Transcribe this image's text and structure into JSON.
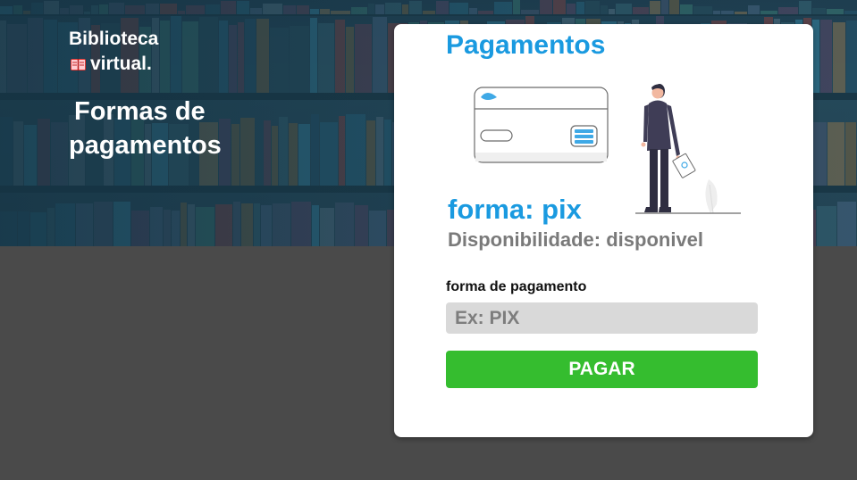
{
  "brand": {
    "line1": "Biblioteca",
    "line2": "virtual.",
    "icon": "book-icon"
  },
  "page_title": {
    "line1": "Formas de",
    "line2": "pagamentos"
  },
  "card": {
    "title": "Pagamentos",
    "illustration": "payment-card-person-illustration",
    "method_label": "forma: pix",
    "availability_label": "Disponibilidade: disponivel",
    "input_label": "forma de pagamento",
    "input_value": "",
    "input_placeholder": "Ex: PIX",
    "button_label": "PAGAR"
  },
  "colors": {
    "accent_blue": "#1a9ae0",
    "button_green": "#35bd2f",
    "hero_overlay": "#143242",
    "lower_background": "#4a4a4a",
    "input_background": "#d9d9d9"
  }
}
